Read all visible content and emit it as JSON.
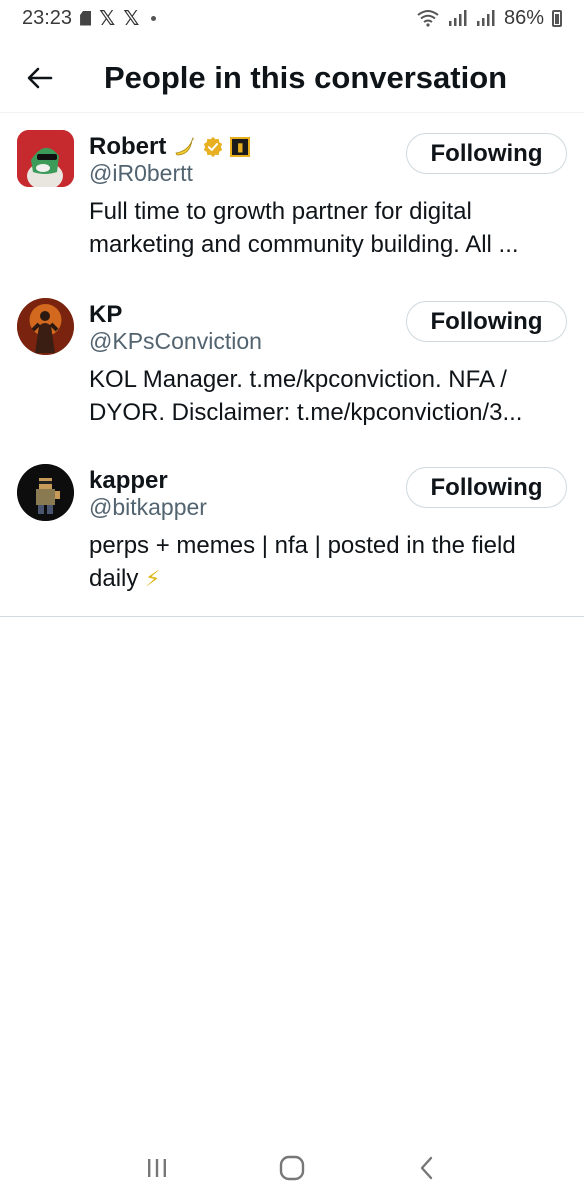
{
  "status_bar": {
    "time": "23:23",
    "battery": "86%",
    "icons": [
      "sd-card-icon",
      "x-logo-icon",
      "x-logo-icon",
      "notification-dot-icon",
      "wifi-icon",
      "signal-icon",
      "signal-icon",
      "battery-icon"
    ]
  },
  "header": {
    "title": "People in this conversation",
    "back_icon": "arrow-left-icon"
  },
  "people": [
    {
      "name": "Robert",
      "name_emoji": "banana",
      "verified": true,
      "affiliate_badge": true,
      "handle": "@iR0bertt",
      "bio": "Full time to growth partner for digital marketing and community building. All ...",
      "follow_label": "Following"
    },
    {
      "name": "KP",
      "handle": "@KPsConviction",
      "bio": "KOL Manager. t.me/kpconviction. NFA / DYOR. Disclaimer: t.me/kpconviction/3...",
      "follow_label": "Following"
    },
    {
      "name": "kapper",
      "handle": "@bitkapper",
      "bio": "perps + memes | nfa | posted in the field daily",
      "bio_emoji": "⚡",
      "follow_label": "Following"
    }
  ],
  "nav_bar": {
    "icons": [
      "recent-apps-icon",
      "home-icon",
      "back-icon"
    ]
  },
  "colors": {
    "text_primary": "#0f1419",
    "text_secondary": "#536471",
    "border": "#cfd9de",
    "verified_gold": "#e8b020"
  }
}
